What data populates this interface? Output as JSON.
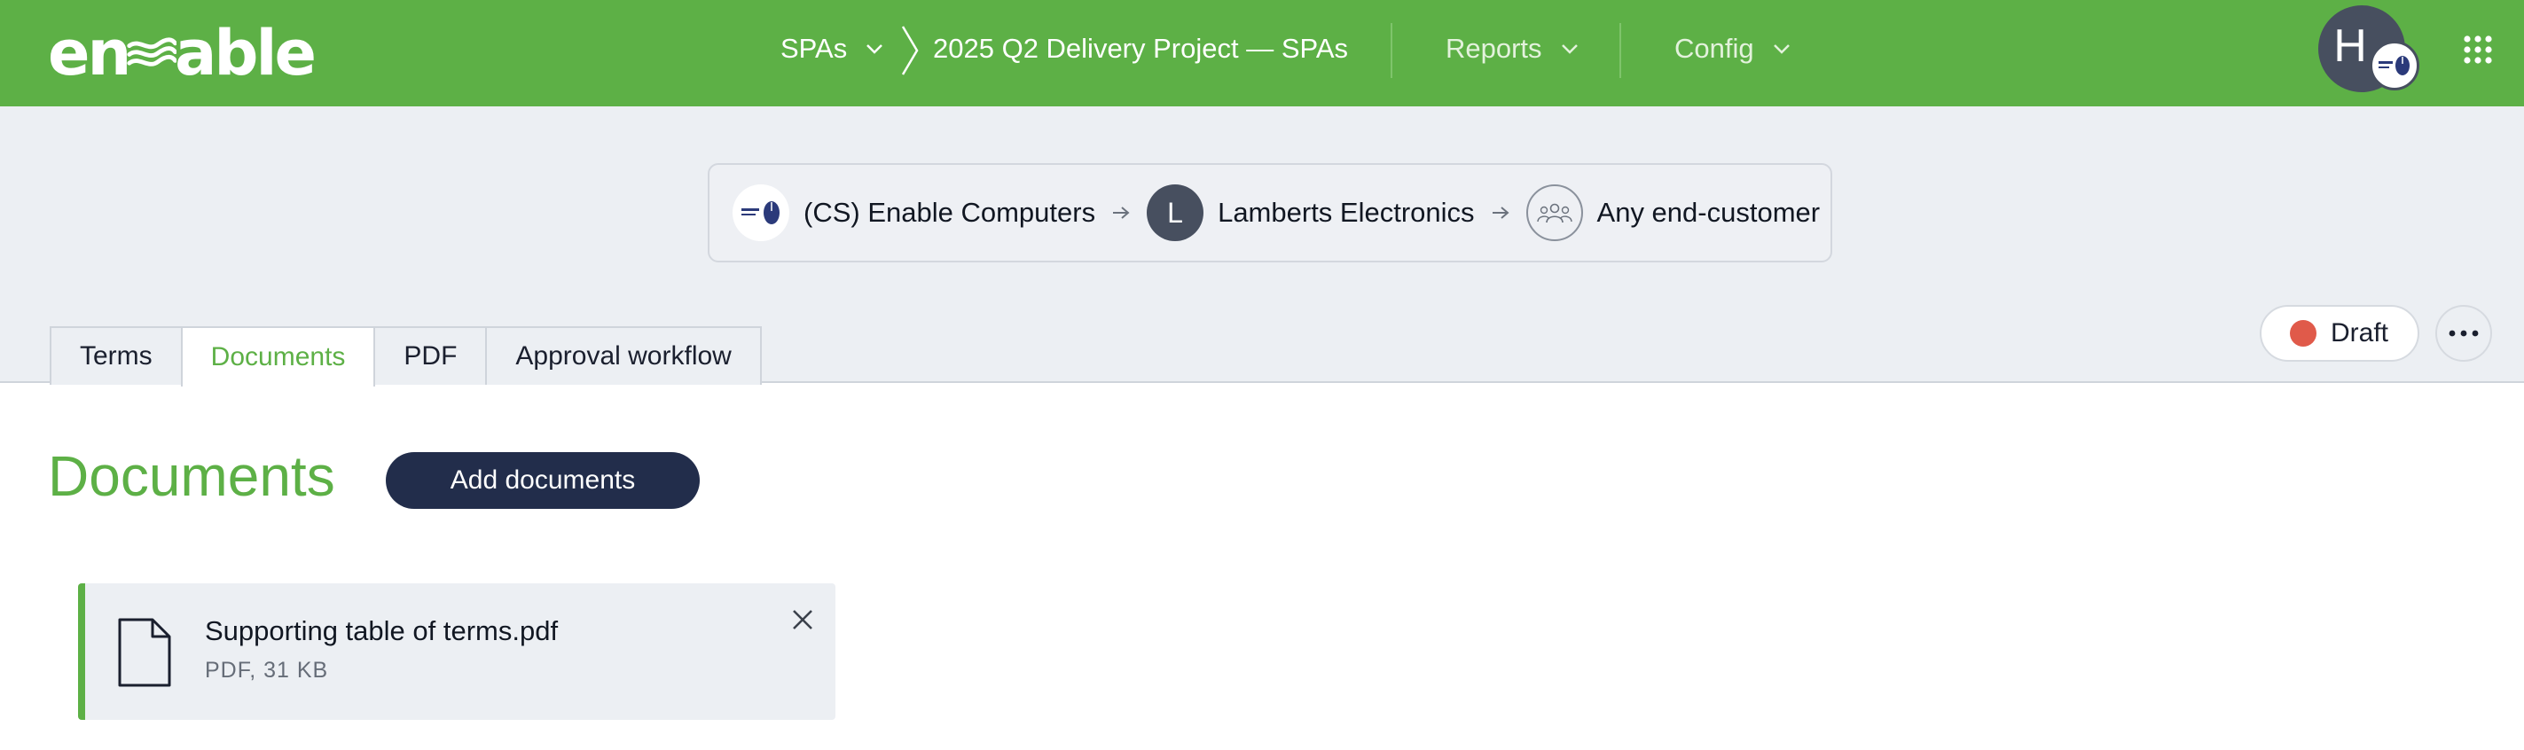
{
  "brand": {
    "logo_left": "en",
    "logo_right": "able",
    "color": "#5db046"
  },
  "nav": {
    "section": "SPAs",
    "project": "2025 Q2 Delivery Project — SPAs",
    "reports": "Reports",
    "config": "Config"
  },
  "user": {
    "initial": "H"
  },
  "parties": {
    "from": "(CS) Enable Computers",
    "distributor_initial": "L",
    "distributor": "Lamberts Electronics",
    "to": "Any end-customer"
  },
  "tabs": [
    {
      "label": "Terms"
    },
    {
      "label": "Documents",
      "active": true
    },
    {
      "label": "PDF"
    },
    {
      "label": "Approval workflow"
    }
  ],
  "status": {
    "label": "Draft",
    "color": "#e05a4a"
  },
  "main": {
    "title": "Documents",
    "add_button": "Add documents"
  },
  "documents": [
    {
      "name": "Supporting table of terms.pdf",
      "meta": "PDF, 31 KB"
    }
  ],
  "icons": [
    "chevron-down-icon",
    "breadcrumb-chevron-icon",
    "apps-grid-icon",
    "arrow-right-icon",
    "group-icon",
    "more-icon",
    "file-icon",
    "close-icon"
  ]
}
